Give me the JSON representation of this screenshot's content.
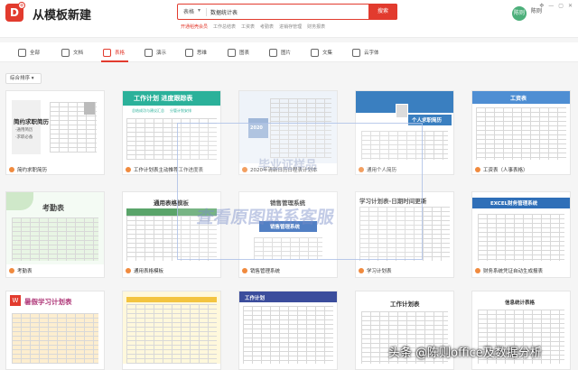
{
  "app": {
    "logo_char": "D",
    "logo_plus": "+",
    "title": "从模板新建"
  },
  "search": {
    "category": "表格",
    "category_arrow": "▾",
    "placeholder": "",
    "value": "数据统计表",
    "button": "搜索"
  },
  "hot_links": [
    "开通稻壳会员",
    "工作总结表",
    "工资表",
    "考勤表",
    "进销存管理",
    "财务报表"
  ],
  "user": {
    "avatar": "陈则",
    "name": "陈则",
    "sub": ""
  },
  "window": {
    "pin": "✥",
    "min": "—",
    "max": "▢",
    "close": "✕"
  },
  "tabs": [
    {
      "label": "全部",
      "icon": "grid-icon"
    },
    {
      "label": "文档",
      "icon": "document-icon"
    },
    {
      "label": "表格",
      "icon": "spreadsheet-icon"
    },
    {
      "label": "演示",
      "icon": "presentation-icon"
    },
    {
      "label": "思维",
      "icon": "mindmap-icon"
    },
    {
      "label": "图表",
      "icon": "chart-icon"
    },
    {
      "label": "图片",
      "icon": "image-icon"
    },
    {
      "label": "文集",
      "icon": "collection-icon"
    },
    {
      "label": "云字体",
      "icon": "font-icon"
    }
  ],
  "active_tab": "表格",
  "sort": {
    "label": "综合排序 ▾"
  },
  "thumb_text": {
    "resume": [
      "简约求职简历",
      "·通用简历",
      "·求职必备"
    ],
    "worksheet": [
      "工作计划 进度跟踪表",
      "总结成功与建议汇总",
      "分管计划安排"
    ],
    "calendar": [
      "2020"
    ],
    "personal": [
      "个人求职简历"
    ],
    "salary": [
      "工资表"
    ],
    "attendance": [
      "考勤表"
    ],
    "general": [
      "通用表格模板"
    ],
    "sales": [
      "销售管理系统",
      "销售管理系统"
    ],
    "study": [
      "学习计划表-日期时间更新"
    ],
    "finance": [
      "EXCEL财务管理系统"
    ],
    "summer": [
      "暑假学习计划表"
    ],
    "workplan": [
      "工作计划"
    ],
    "workplan2": [
      "工作计划表"
    ],
    "info": [
      "信息统计表格"
    ]
  },
  "cards": [
    {
      "title": "简约求职简历"
    },
    {
      "title": "工作计划表主动推荐工作进度表"
    },
    {
      "title": "2020年清新日历日程表计划本"
    },
    {
      "title": "通用个人简历"
    },
    {
      "title": "工资表（人事表格）"
    },
    {
      "title": "考勤表"
    },
    {
      "title": "通用表格模板"
    },
    {
      "title": "销售管理系统"
    },
    {
      "title": "学习计划表"
    },
    {
      "title": "财务系统凭证自动生成报表"
    }
  ],
  "watermarks": {
    "center": "查看原图联系客服",
    "top": "毕业证样品"
  },
  "footer_watermark": "头条 @陈则office及数据分析"
}
